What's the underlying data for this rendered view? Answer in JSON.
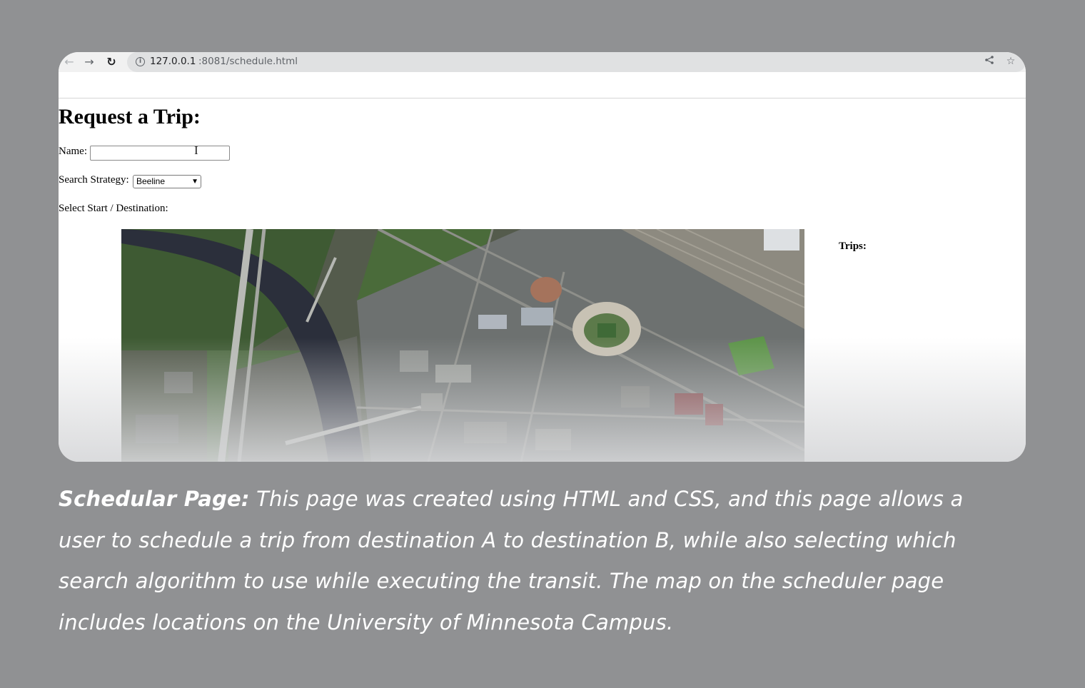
{
  "browser": {
    "back_icon": "back-arrow-icon",
    "forward_icon": "forward-arrow-icon",
    "reload_icon": "reload-icon",
    "url_host": "127.0.0.1",
    "url_path": ":8081/schedule.html",
    "share_icon": "share-icon",
    "bookmark_icon": "star-icon"
  },
  "page": {
    "title": "Request a Trip:",
    "name_label": "Name:",
    "name_value": "",
    "strategy_label": "Search Strategy:",
    "strategy_selected": "Beeline",
    "destination_label": "Select Start / Destination:",
    "trips_label": "Trips:",
    "map_description": "aerial-campus-map"
  },
  "caption": {
    "bold": "Schedular Page:",
    "text": " This page was created using HTML and CSS, and this page allows a user to schedule a trip from destination A to destination B, while also selecting which search algorithm to use while executing the transit. The map on the scheduler page includes locations on the University of Minnesota Campus."
  },
  "colors": {
    "background": "#909193",
    "card": "#ffffff",
    "caption_text": "#ffffff"
  }
}
